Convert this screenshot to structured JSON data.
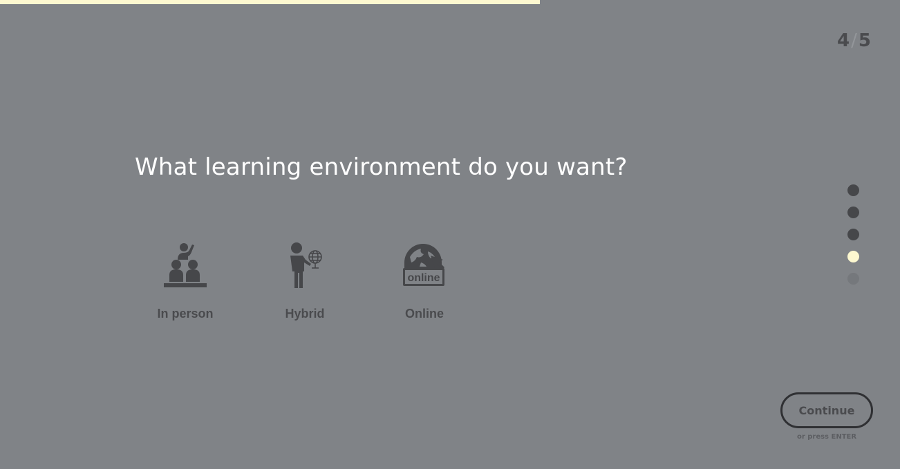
{
  "progress": {
    "fraction": 0.6
  },
  "counter": {
    "current": "4",
    "separator": "/",
    "total": "5"
  },
  "question": {
    "text": "What learning environment do you want?"
  },
  "options": [
    {
      "label": "In person",
      "icon": "classroom-icon"
    },
    {
      "label": "Hybrid",
      "icon": "teacher-globe-icon"
    },
    {
      "label": "Online",
      "icon": "online-globe-icon"
    }
  ],
  "step_dots": [
    {
      "state": "done"
    },
    {
      "state": "done"
    },
    {
      "state": "done"
    },
    {
      "state": "current"
    },
    {
      "state": "upcoming"
    }
  ],
  "continue": {
    "label": "Continue",
    "hint": "or press ENTER"
  },
  "colors": {
    "background": "#808387",
    "accent": "#fdf8d0",
    "dark": "#4a4b4e",
    "dot_done": "#46474a",
    "dot_upcoming": "#75787c"
  }
}
